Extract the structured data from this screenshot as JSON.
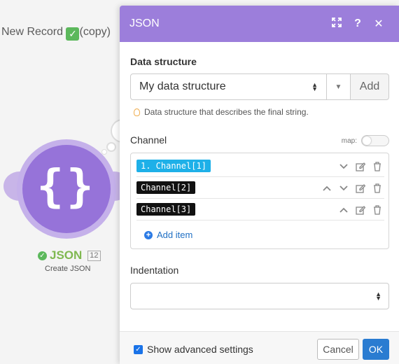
{
  "canvas": {
    "background_title": "New Record",
    "background_title_suffix": "(copy)",
    "background_title_check": "✓",
    "node_name": "JSON",
    "node_number": "12",
    "node_subtitle": "Create JSON",
    "node_icon": "braces-icon",
    "node_status_icon": "check-icon"
  },
  "modal": {
    "title": "JSON",
    "header_icons": [
      "expand-icon",
      "help-icon",
      "close-icon"
    ],
    "help_glyph": "?",
    "close_glyph": "✕",
    "data_structure": {
      "label": "Data structure",
      "selected": "My data structure",
      "add_label": "Add",
      "hint": "Data structure that describes the final string."
    },
    "channel": {
      "label": "Channel",
      "map_label": "map:",
      "map_enabled": false,
      "items": [
        {
          "tag": "1. Channel[1]",
          "style": "blue"
        },
        {
          "tag": "Channel[2]",
          "style": "black"
        },
        {
          "tag": "Channel[3]",
          "style": "black"
        }
      ],
      "add_item_label": "Add item"
    },
    "indentation": {
      "label": "Indentation",
      "selected": ""
    },
    "footer": {
      "show_advanced_label": "Show advanced settings",
      "show_advanced_checked": true,
      "cancel_label": "Cancel",
      "ok_label": "OK"
    }
  },
  "colors": {
    "header_purple": "#9c7edb",
    "node_purple": "#9673d9",
    "tag_blue": "#1eb0e8",
    "ok_blue": "#2a7cd1",
    "success_green": "#5cb85c"
  }
}
